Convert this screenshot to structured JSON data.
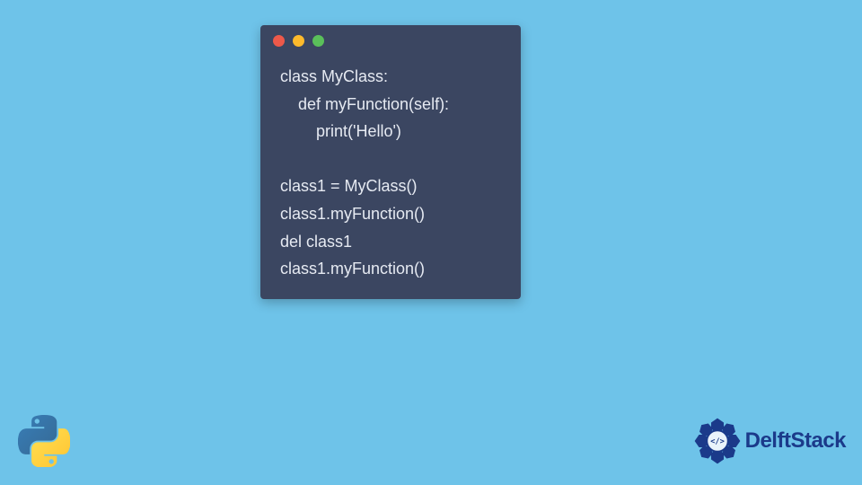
{
  "code": {
    "lines": [
      "class MyClass:",
      "    def myFunction(self):",
      "        print('Hello')",
      "",
      "class1 = MyClass()",
      "class1.myFunction()",
      "del class1",
      "class1.myFunction()"
    ]
  },
  "brand": {
    "name": "DelftStack"
  },
  "colors": {
    "bg": "#6ec3e9",
    "window": "#3b4661",
    "text": "#e6eaf2",
    "brand": "#1b3a8a"
  }
}
